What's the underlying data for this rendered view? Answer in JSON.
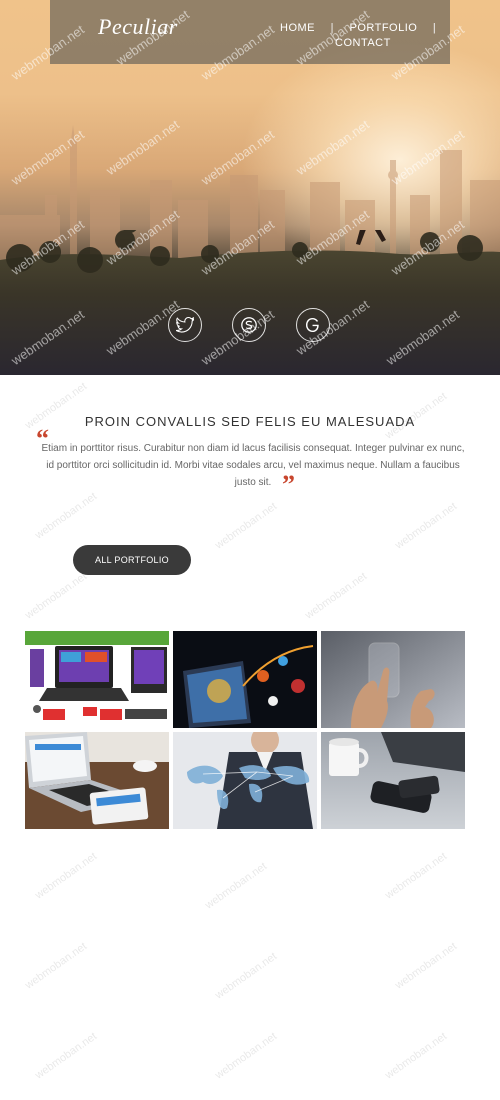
{
  "header": {
    "logo": "Peculiar",
    "nav": [
      {
        "label": "HOME"
      },
      {
        "label": "PORTFOLIO"
      },
      {
        "label": "CONTACT"
      }
    ],
    "separator": "|"
  },
  "hero": {
    "social": [
      {
        "icon": "twitter-icon"
      },
      {
        "icon": "skype-icon"
      },
      {
        "icon": "google-plus-icon"
      }
    ]
  },
  "intro": {
    "heading": "PROIN CONVALLIS SED FELIS EU MALESUADA",
    "open_quote": "“",
    "close_quote": "”",
    "quote": "Etiam in porttitor risus. Curabitur non diam id lacus facilisis consequat. Integer pulvinar ex nunc, id porttitor orci sollicitudin id. Morbi vitae sodales arcu, vel maximus neque. Nullam a faucibus justo sit."
  },
  "portfolio": {
    "button_label": "ALL PORTFOLIO"
  },
  "watermark": "webmoban.net",
  "colors": {
    "accent": "#c8462e",
    "button": "#3a3a3a",
    "topbar": "#786e5f"
  }
}
